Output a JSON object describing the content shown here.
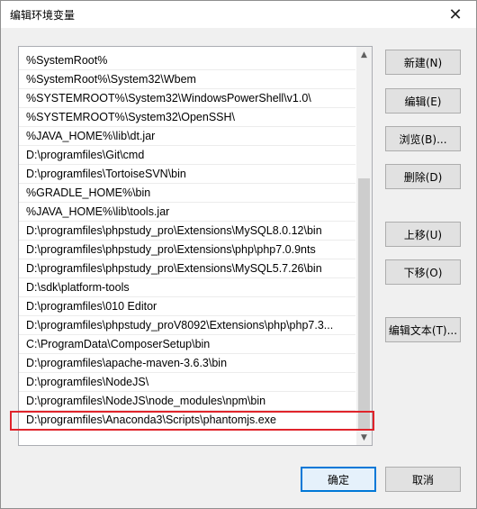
{
  "dialog": {
    "title": "编辑环境变量",
    "close_glyph": "✕"
  },
  "path_list": {
    "entries": [
      "%SystemRoot%",
      "%SystemRoot%\\System32\\Wbem",
      "%SYSTEMROOT%\\System32\\WindowsPowerShell\\v1.0\\",
      "%SYSTEMROOT%\\System32\\OpenSSH\\",
      "%JAVA_HOME%\\lib\\dt.jar",
      "D:\\programfiles\\Git\\cmd",
      "D:\\programfiles\\TortoiseSVN\\bin",
      "%GRADLE_HOME%\\bin",
      "%JAVA_HOME%\\lib\\tools.jar",
      "D:\\programfiles\\phpstudy_pro\\Extensions\\MySQL8.0.12\\bin",
      "D:\\programfiles\\phpstudy_pro\\Extensions\\php\\php7.0.9nts",
      "D:\\programfiles\\phpstudy_pro\\Extensions\\MySQL5.7.26\\bin",
      "D:\\sdk\\platform-tools",
      "D:\\programfiles\\010 Editor",
      "D:\\programfiles\\phpstudy_proV8092\\Extensions\\php\\php7.3...",
      "C:\\ProgramData\\ComposerSetup\\bin",
      "D:\\programfiles\\apache-maven-3.6.3\\bin",
      "D:\\programfiles\\NodeJS\\",
      "D:\\programfiles\\NodeJS\\node_modules\\npm\\bin",
      "D:\\programfiles\\Anaconda3\\Scripts\\phantomjs.exe"
    ],
    "highlighted_entry": "D:\\programfiles\\Anaconda3\\Scripts\\phantomjs.exe",
    "highlight_color": "#e0242b",
    "scroll_up_glyph": "▲",
    "scroll_down_glyph": "▼"
  },
  "buttons": {
    "new": "新建(N)",
    "edit": "编辑(E)",
    "browse": "浏览(B)...",
    "delete": "删除(D)",
    "move_up": "上移(U)",
    "move_down": "下移(O)",
    "edit_text": "编辑文本(T)...",
    "ok": "确定",
    "cancel": "取消"
  },
  "colors": {
    "accent": "#0078d7",
    "dialog_bg": "#f0f0f0"
  }
}
